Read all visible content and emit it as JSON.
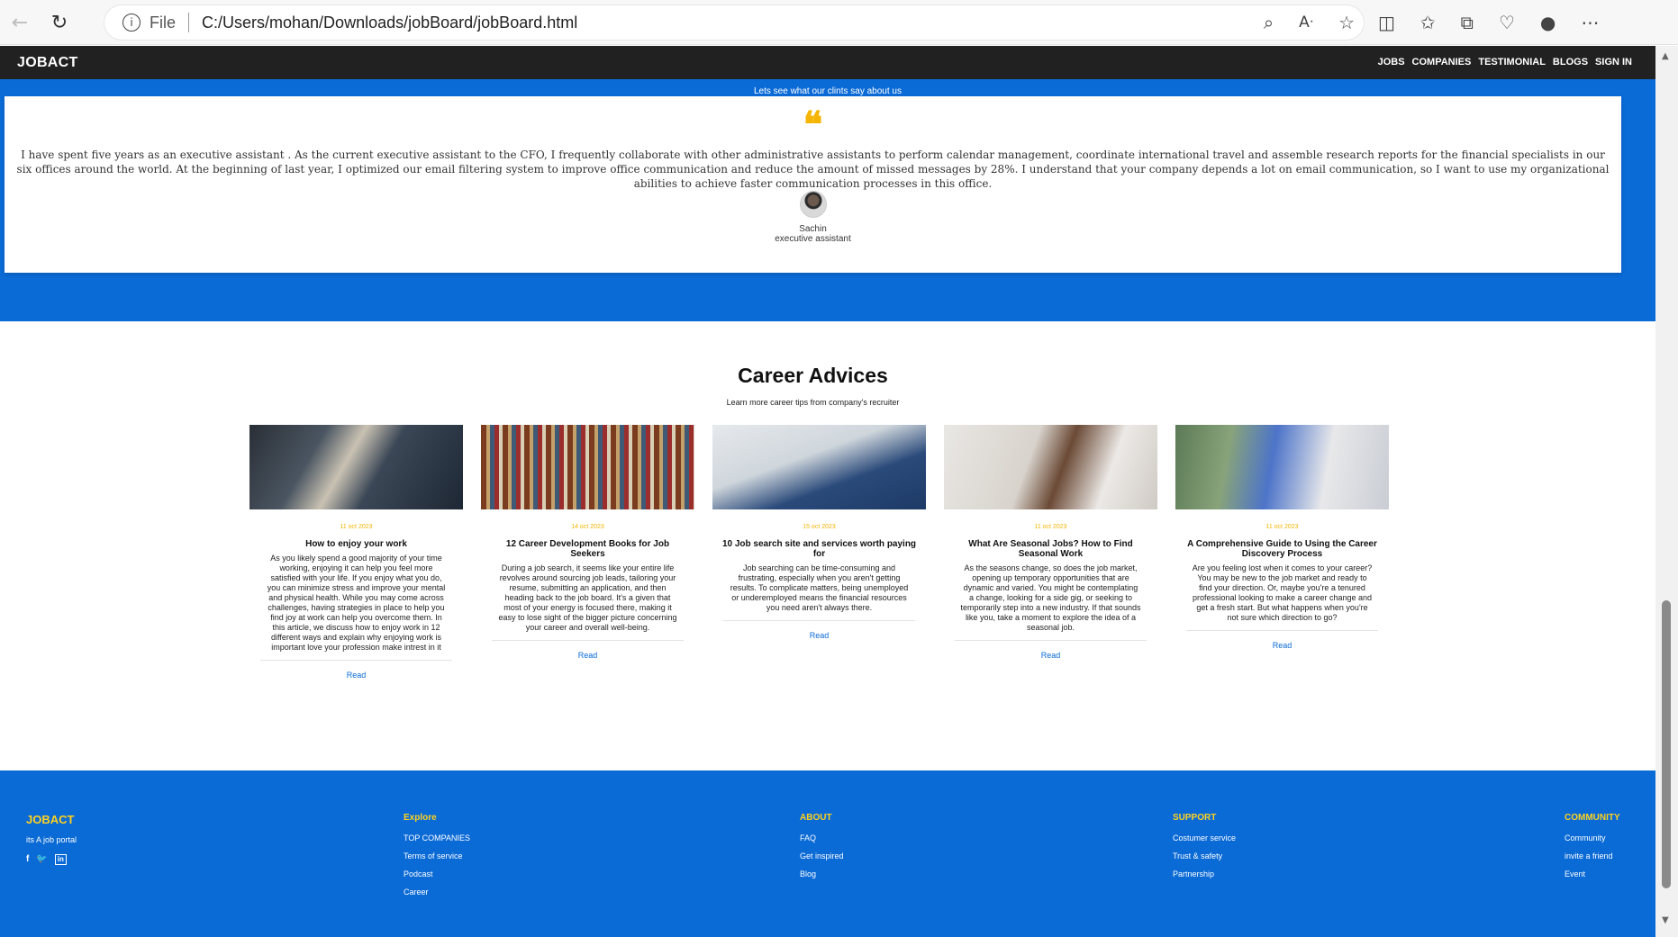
{
  "browser": {
    "file_label": "File",
    "url": "C:/Users/mohan/Downloads/jobBoard/jobBoard.html"
  },
  "nav": {
    "brand": "JOBACT",
    "links": [
      "JOBS",
      "COMPANIES",
      "TESTIMONIAL",
      "BLOGS",
      "SIGN IN"
    ]
  },
  "testimonial": {
    "caption": "Lets see what our clints say about us",
    "quote": "I have spent five years as an executive assistant . As the current executive assistant to the CFO, I frequently collaborate with other administrative assistants to perform calendar management, coordinate international travel and assemble research reports for the financial specialists in our six offices around the world. At the beginning of last year, I optimized our email filtering system to improve office communication and reduce the amount of missed messages by 28%. I understand that your company depends a lot on email communication, so I want to use my organizational abilities to achieve faster communication processes in this office.",
    "name": "Sachin",
    "role": "executive assistant"
  },
  "advices": {
    "title": "Career Advices",
    "subtitle": "Learn more career tips from company's recruiter",
    "read_label": "Read",
    "cards": [
      {
        "date": "11 oct 2023",
        "title": "How to enjoy your work",
        "body": "As you likely spend a good majority of your time working, enjoying it can help you feel more satisfied with your life. If you enjoy what you do, you can minimize stress and improve your mental and physical health. While you may come across challenges, having strategies in place to help you find joy at work can help you overcome them. In this article, we discuss how to enjoy work in 12 different ways and explain why enjoying work is important love your profession make intrest in it"
      },
      {
        "date": "14 oct 2023",
        "title": "12 Career Development Books for Job Seekers",
        "body": "During a job search, it seems like your entire life revolves around sourcing job leads, tailoring your resume, submitting an application, and then heading back to the job board. It's a given that most of your energy is focused there, making it easy to lose sight of the bigger picture concerning your career and overall well-being."
      },
      {
        "date": "15 oct 2023",
        "title": "10 Job search site and services worth paying for",
        "body": "Job searching can be time-consuming and frustrating, especially when you aren't getting results. To complicate matters, being unemployed or underemployed means the financial resources you need aren't always there."
      },
      {
        "date": "11 oct 2023",
        "title": "What Are Seasonal Jobs? How to Find Seasonal Work",
        "body": "As the seasons change, so does the job market, opening up temporary opportunities that are dynamic and varied. You might be contemplating a change, looking for a side gig, or seeking to temporarily step into a new industry. If that sounds like you, take a moment to explore the idea of a seasonal job."
      },
      {
        "date": "11 oct 2023",
        "title": "A Comprehensive Guide to Using the Career Discovery Process",
        "body": "Are you feeling lost when it comes to your career? You may be new to the job market and ready to find your direction. Or, maybe you're a tenured professional looking to make a career change and get a fresh start. But what happens when you're not sure which direction to go?"
      }
    ]
  },
  "footer": {
    "brand": "JOBACT",
    "tagline": "its A job portal",
    "social": [
      "f",
      "t",
      "in"
    ],
    "columns": [
      {
        "heading": "Explore",
        "links": [
          "TOP COMPANIES",
          "Terms of service",
          "Podcast",
          "Career"
        ]
      },
      {
        "heading": "ABOUT",
        "links": [
          "FAQ",
          "Get inspired",
          "Blog"
        ]
      },
      {
        "heading": "SUPPORT",
        "links": [
          "Costumer service",
          "Trust & safety",
          "Partnership"
        ]
      },
      {
        "heading": "COMMUNITY",
        "links": [
          "Community",
          "invite a friend",
          "Event"
        ]
      }
    ]
  },
  "colors": {
    "primary_blue": "#0a6ad6",
    "accent_yellow": "#f5b500",
    "nav_dark": "#212121"
  }
}
